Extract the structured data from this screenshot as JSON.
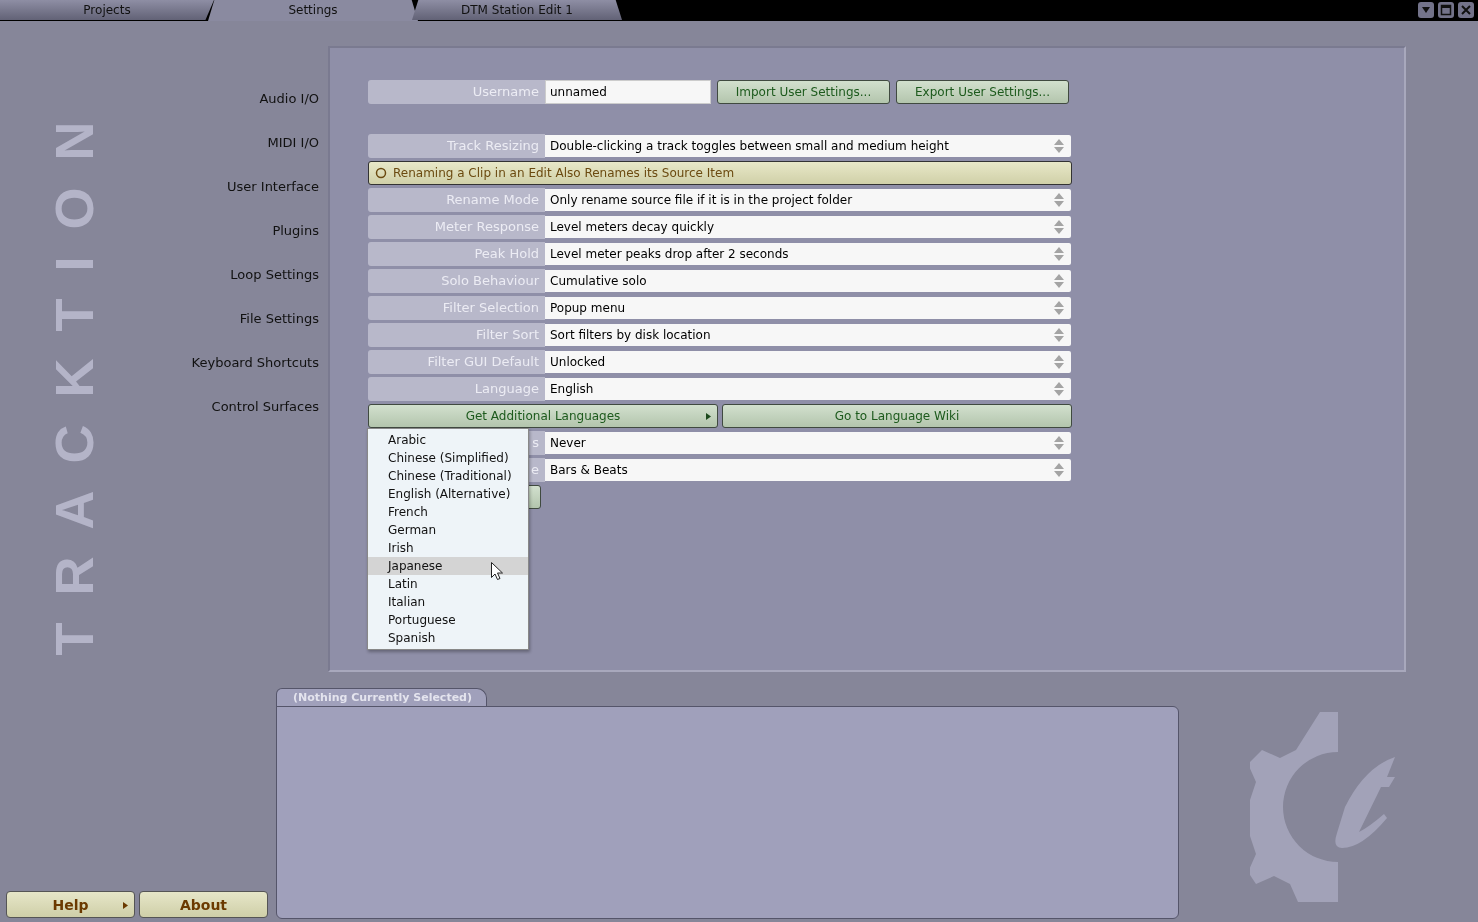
{
  "tabs": [
    {
      "label": "Projects",
      "selected": false
    },
    {
      "label": "Settings",
      "selected": true
    },
    {
      "label": "DTM Station Edit 1",
      "selected": false
    }
  ],
  "window_buttons": [
    {
      "kind": "minimize"
    },
    {
      "kind": "maximize"
    },
    {
      "kind": "close"
    }
  ],
  "sidebar": {
    "logo": "TRACKTION",
    "items": [
      "Audio I/O",
      "MIDI I/O",
      "User Interface",
      "Plugins",
      "Loop Settings",
      "File Settings",
      "Keyboard Shortcuts",
      "Control Surfaces"
    ]
  },
  "settings": {
    "user_row": {
      "label": "Username",
      "value": "unnamed",
      "buttons": [
        "Import User Settings...",
        "Export User Settings..."
      ]
    },
    "rows": [
      {
        "kind": "select",
        "label": "Track Resizing",
        "value": "Double-clicking a track toggles between small and medium height"
      },
      {
        "kind": "toggle",
        "label": "Renaming a Clip in an Edit Also Renames its Source Item",
        "checked": false
      },
      {
        "kind": "select",
        "label": "Rename Mode",
        "value": "Only rename source file if it is in the project folder"
      },
      {
        "kind": "select",
        "label": "Meter Response",
        "value": "Level meters decay quickly"
      },
      {
        "kind": "select",
        "label": "Peak Hold",
        "value": "Level meter peaks drop after 2 seconds"
      },
      {
        "kind": "select",
        "label": "Solo Behaviour",
        "value": "Cumulative solo"
      },
      {
        "kind": "select",
        "label": "Filter Selection",
        "value": "Popup menu"
      },
      {
        "kind": "select",
        "label": "Filter Sort",
        "value": "Sort filters by disk location"
      },
      {
        "kind": "select",
        "label": "Filter GUI Default",
        "value": "Unlocked"
      },
      {
        "kind": "select",
        "label": "Language",
        "value": "English"
      },
      {
        "kind": "buttons",
        "buttons": [
          {
            "label": "Get Additional Languages",
            "has_submenu": true
          },
          {
            "label": "Go to Language Wiki",
            "has_submenu": false
          }
        ]
      },
      {
        "kind": "select",
        "label": "s",
        "value": "Never"
      },
      {
        "kind": "select",
        "label": "e",
        "value": "Bars & Beats"
      },
      {
        "kind": "hidden_button"
      }
    ]
  },
  "popup": {
    "items": [
      {
        "label": "Arabic",
        "selected": false
      },
      {
        "label": "Chinese (Simplified)",
        "selected": false
      },
      {
        "label": "Chinese (Traditional)",
        "selected": false
      },
      {
        "label": "English (Alternative)",
        "selected": false
      },
      {
        "label": "French",
        "selected": false
      },
      {
        "label": "German",
        "selected": false
      },
      {
        "label": "Irish",
        "selected": false
      },
      {
        "label": "Japanese",
        "selected": true
      },
      {
        "label": "Latin",
        "selected": false
      },
      {
        "label": "Italian",
        "selected": false
      },
      {
        "label": "Portuguese",
        "selected": false
      },
      {
        "label": "Spanish",
        "selected": false
      }
    ]
  },
  "properties_panel": {
    "tab": "(Nothing Currently Selected)"
  },
  "footer_buttons": [
    {
      "label": "Help",
      "has_submenu": true
    },
    {
      "label": "About",
      "has_submenu": false
    }
  ]
}
